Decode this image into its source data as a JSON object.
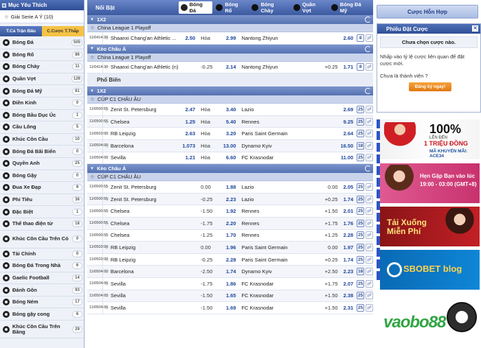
{
  "left": {
    "favorites_title": "Mục Yêu Thích",
    "favorite_item": "Giải Serie A Ý (10)",
    "tabs": [
      "T.Cả Trận Đấu",
      "C.Cược T.Thắp"
    ],
    "sports": [
      {
        "label": "Bóng Đá",
        "count": "505",
        "icon": "soccer-ball-icon"
      },
      {
        "label": "Bóng Rổ",
        "count": "86",
        "icon": "basketball-icon"
      },
      {
        "label": "Bóng Chày",
        "count": "11",
        "icon": "baseball-icon"
      },
      {
        "label": "Quần Vợt",
        "count": "126",
        "icon": "tennis-icon"
      },
      {
        "label": "Bóng Đá Mỹ",
        "count": "81",
        "icon": "american-football-icon"
      },
      {
        "label": "Điền Kinh",
        "count": "0",
        "icon": "athletics-icon"
      },
      {
        "label": "Bóng Bầu Dục Úc",
        "count": "1",
        "icon": "aussie-rules-icon"
      },
      {
        "label": "Cầu Lông",
        "count": "5",
        "icon": "badminton-icon"
      },
      {
        "label": "Khúc Côn Cầu",
        "count": "10",
        "icon": "hockey-icon"
      },
      {
        "label": "Bóng Đá Bãi Biển",
        "count": "0",
        "icon": "beach-soccer-icon"
      },
      {
        "label": "Quyền Anh",
        "count": "25",
        "icon": "boxing-icon"
      },
      {
        "label": "Bóng Gậy",
        "count": "0",
        "icon": "cricket-icon"
      },
      {
        "label": "Đua Xe Đạp",
        "count": "9",
        "icon": "cycling-icon"
      },
      {
        "label": "Phi Tiêu",
        "count": "36",
        "icon": "darts-icon"
      },
      {
        "label": "Đặc Biệt",
        "count": "1",
        "icon": "special-icon"
      },
      {
        "label": "Thể thao điện tử",
        "count": "18",
        "icon": "esports-icon"
      },
      {
        "label": "Khúc Côn Cầu Trên Cỏ",
        "count": "0",
        "icon": "field-hockey-icon",
        "tall": true
      },
      {
        "label": "Tài Chính",
        "count": "0",
        "icon": "finance-icon"
      },
      {
        "label": "Bóng Đá Trong Nhà",
        "count": "6",
        "icon": "futsal-icon"
      },
      {
        "label": "Gaelic Football",
        "count": "14",
        "icon": "gaelic-icon"
      },
      {
        "label": "Đánh Gôn",
        "count": "93",
        "icon": "golf-icon"
      },
      {
        "label": "Bóng Ném",
        "count": "17",
        "icon": "handball-icon"
      },
      {
        "label": "Bóng gậy cong",
        "count": "6",
        "icon": "hurling-icon"
      },
      {
        "label": "Khúc Côn Cầu Trên Băng",
        "count": "29",
        "icon": "ice-hockey-icon",
        "tall": true
      }
    ]
  },
  "main": {
    "title": "Nổi Bật",
    "tabs": [
      {
        "label": "Bóng Đá",
        "active": true
      },
      {
        "label": "Bóng Rổ",
        "active": false
      },
      {
        "label": "Bóng Chày",
        "active": false
      },
      {
        "label": "Quần Vợt",
        "active": false
      },
      {
        "label": "Bóng Đá Mỹ",
        "active": false
      }
    ],
    "featured": [
      {
        "section": "1X2",
        "league": "China League 1 Playoff",
        "rows": [
          {
            "date": "11/04",
            "time": "14:30",
            "home": "Shaanxi Chang'an Athletic ...",
            "hodd": "2.50",
            "mid": "Hòa",
            "midodd": "2.99",
            "away": "Nantong Zhiyun",
            "ahcp": "",
            "aodd": "2.60",
            "more": "8"
          }
        ]
      },
      {
        "section": "Kèo Châu Á",
        "league": "China League 1 Playoff",
        "rows": [
          {
            "date": "11/04",
            "time": "14:30",
            "home": "Shaanxi Chang'an Athletic (n)",
            "hodd": "",
            "mid": "-0.25",
            "midodd": "2.14",
            "away": "Nantong Zhiyun",
            "ahcp": "+0.25",
            "aodd": "1.71",
            "more": "8"
          }
        ]
      }
    ],
    "popular_title": "Phổ Biến",
    "popular": [
      {
        "section": "1X2",
        "league": "CÚP C1 CHÂU ÂU",
        "rows": [
          {
            "date": "11/05",
            "time": "00:55",
            "home": "Zenit St. Petersburg",
            "hodd": "2.47",
            "mid": "Hòa",
            "midodd": "3.40",
            "away": "Lazio",
            "ahcp": "",
            "aodd": "2.69",
            "more": "25"
          },
          {
            "date": "11/05",
            "time": "00:55",
            "home": "Chelsea",
            "hodd": "1.25",
            "mid": "Hòa",
            "midodd": "5.40",
            "away": "Rennes",
            "ahcp": "",
            "aodd": "9.25",
            "more": "25"
          },
          {
            "date": "11/05",
            "time": "03:00",
            "home": "RB Leipzig",
            "hodd": "2.63",
            "mid": "Hòa",
            "midodd": "3.20",
            "away": "Paris Saint Germain",
            "ahcp": "",
            "aodd": "2.64",
            "more": "25"
          },
          {
            "date": "11/05",
            "time": "04:00",
            "home": "Barcelona",
            "hodd": "1.073",
            "mid": "Hòa",
            "midodd": "13.00",
            "away": "Dynamo Kyiv",
            "ahcp": "",
            "aodd": "16.50",
            "more": "18"
          },
          {
            "date": "11/05",
            "time": "04:00",
            "home": "Sevilla",
            "hodd": "1.21",
            "mid": "Hòa",
            "midodd": "6.60",
            "away": "FC Krasnodar",
            "ahcp": "",
            "aodd": "11.00",
            "more": "25"
          }
        ]
      },
      {
        "section": "Kèo Châu Á",
        "league": "CÚP C1 CHÂU ÂU",
        "rows": [
          {
            "date": "11/05",
            "time": "00:55",
            "home": "Zenit St. Petersburg",
            "hodd": "",
            "mid": "0.00",
            "midodd": "1.88",
            "away": "Lazio",
            "ahcp": "0.00",
            "aodd": "2.05",
            "more": "25"
          },
          {
            "date": "11/05",
            "time": "00:55",
            "home": "Zenit St. Petersburg",
            "hodd": "",
            "mid": "-0.25",
            "midodd": "2.23",
            "away": "Lazio",
            "ahcp": "+0.25",
            "aodd": "1.74",
            "more": "25"
          },
          {
            "date": "11/05",
            "time": "00:55",
            "home": "Chelsea",
            "hodd": "",
            "mid": "-1.50",
            "midodd": "1.92",
            "away": "Rennes",
            "ahcp": "+1.50",
            "aodd": "2.01",
            "more": "25"
          },
          {
            "date": "11/05",
            "time": "00:55",
            "home": "Chelsea",
            "hodd": "",
            "mid": "-1.75",
            "midodd": "2.20",
            "away": "Rennes",
            "ahcp": "+1.75",
            "aodd": "1.76",
            "more": "25"
          },
          {
            "date": "11/05",
            "time": "00:55",
            "home": "Chelsea",
            "hodd": "",
            "mid": "-1.25",
            "midodd": "1.70",
            "away": "Rennes",
            "ahcp": "+1.25",
            "aodd": "2.28",
            "more": "25"
          },
          {
            "date": "11/05",
            "time": "03:00",
            "home": "RB Leipzig",
            "hodd": "",
            "mid": "0.00",
            "midodd": "1.96",
            "away": "Paris Saint Germain",
            "ahcp": "0.00",
            "aodd": "1.97",
            "more": "25"
          },
          {
            "date": "11/05",
            "time": "03:00",
            "home": "RB Leipzig",
            "hodd": "",
            "mid": "-0.25",
            "midodd": "2.28",
            "away": "Paris Saint Germain",
            "ahcp": "+0.25",
            "aodd": "1.74",
            "more": "25"
          },
          {
            "date": "11/05",
            "time": "04:00",
            "home": "Barcelona",
            "hodd": "",
            "mid": "-2.50",
            "midodd": "1.74",
            "away": "Dynamo Kyiv",
            "ahcp": "+2.50",
            "aodd": "2.23",
            "more": "18"
          },
          {
            "date": "11/05",
            "time": "04:00",
            "home": "Sevilla",
            "hodd": "",
            "mid": "-1.75",
            "midodd": "1.86",
            "away": "FC Krasnodar",
            "ahcp": "+1.75",
            "aodd": "2.07",
            "more": "25"
          },
          {
            "date": "11/05",
            "time": "04:00",
            "home": "Sevilla",
            "hodd": "",
            "mid": "-1.50",
            "midodd": "1.65",
            "away": "FC Krasnodar",
            "ahcp": "+1.50",
            "aodd": "2.38",
            "more": "25"
          },
          {
            "date": "11/05",
            "time": "04:00",
            "home": "Sevilla",
            "hodd": "",
            "mid": "-1.50",
            "midodd": "1.69",
            "away": "FC Krasnodar",
            "ahcp": "+1.50",
            "aodd": "2.31",
            "more": "25"
          }
        ]
      }
    ]
  },
  "right": {
    "combo_button": "Cược Hỗn Hợp",
    "slip_title": "Phiếu Đặt Cược",
    "slip_empty": "Chưa chọn cược nào.",
    "slip_msg": "Nhấp vào tỷ lệ cược liên quan để đặt cược mới.",
    "slip_question": "Chưa là thành viên ?",
    "register": "Đăng ký ngay!",
    "banners": [
      {
        "a": "100%",
        "b": "LÊN ĐẾN",
        "c": "1 TRIỆU ĐỒNG",
        "d": "MÃ KHUYẾN MÃI: ACE34"
      },
      {
        "a": "Hẹn Gặp Bạn vào lúc",
        "b": "19:00 - 03:00 (GMT+8)"
      },
      {
        "a": "Tải Xuống",
        "b": "Miễn Phí"
      },
      {
        "a": "SBOBET",
        "b": "blog"
      }
    ],
    "logo_a": "vaobo",
    "logo_b": "88"
  },
  "colors": {
    "header": "#3b5aa0",
    "accent": "#f6a23c",
    "odds": "#1f47a0"
  }
}
